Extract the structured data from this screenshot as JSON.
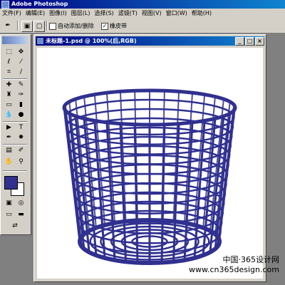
{
  "app": {
    "title": "Adobe Photoshop"
  },
  "menu": [
    "文件(F)",
    "编辑(E)",
    "图像(I)",
    "图层(L)",
    "选择(S)",
    "滤镜(T)",
    "视图(V)",
    "窗口(W)",
    "帮助(H)"
  ],
  "options": {
    "auto_add_delete": "自动添加/删除",
    "rubber_band": "橡皮带"
  },
  "document": {
    "title": "未标题-1.psd @ 100%(后,RGB)"
  },
  "colors": {
    "basket": "#303090",
    "foreground": "#303090",
    "background": "#ffffff",
    "titlebar": "#000080"
  },
  "watermark": {
    "line1": "中国·365设计网",
    "line2": "www.cn365design.com"
  }
}
